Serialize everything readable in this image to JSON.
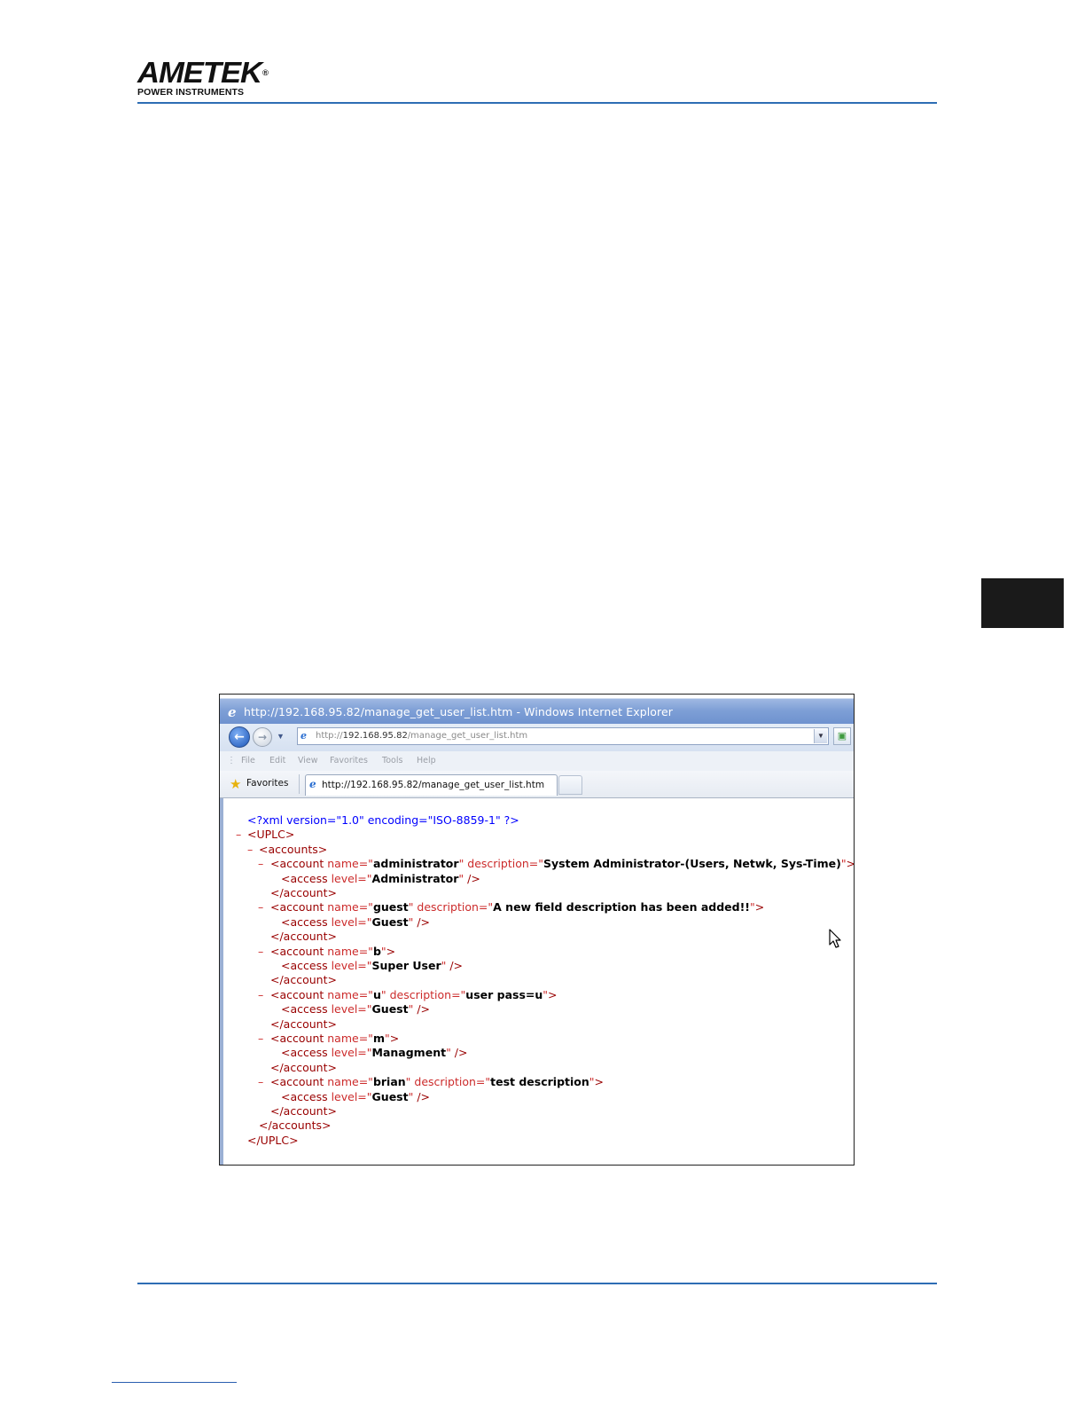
{
  "header": {
    "logo_text": "AMETEK",
    "logo_registered": "®",
    "logo_subtitle": "POWER INSTRUMENTS"
  },
  "browser": {
    "title": "http://192.168.95.82/manage_get_user_list.htm - Windows Internet Explorer",
    "address": {
      "protocol": "http://",
      "host": "192.168.95.82",
      "path": "/manage_get_user_list.htm"
    },
    "menu": [
      "File",
      "Edit",
      "View",
      "Favorites",
      "Tools",
      "Help"
    ],
    "favorites_label": "Favorites",
    "tab_label": "http://192.168.95.82/manage_get_user_list.htm",
    "icons": {
      "back": "back-arrow-icon",
      "forward": "forward-arrow-icon",
      "dropdown": "chevron-down-icon",
      "ie_page": "ie-logo-icon",
      "compat": "compatibility-view-icon",
      "favorites": "star-icon",
      "cursor": "mouse-pointer-icon"
    }
  },
  "xml": {
    "declaration": "<?xml version=\"1.0\" encoding=\"ISO-8859-1\" ?>",
    "root_open": "<UPLC>",
    "root_close": "</UPLC>",
    "accounts_open": "<accounts>",
    "accounts_close": "</accounts>",
    "account_close": "</account>",
    "accounts": [
      {
        "name": "administrator",
        "description": "System Administrator-(Users, Netwk, Sys-Time)",
        "level": "Administrator"
      },
      {
        "name": "guest",
        "description": "A new field description has been added!!",
        "level": "Guest"
      },
      {
        "name": "b",
        "description": null,
        "level": "Super User"
      },
      {
        "name": "u",
        "description": "user pass=u",
        "level": "Guest"
      },
      {
        "name": "m",
        "description": null,
        "level": "Managment"
      },
      {
        "name": "brian",
        "description": "test description",
        "level": "Guest"
      }
    ]
  },
  "colors": {
    "rule_blue": "#2e6db4",
    "xml_markup_red": "#cc2b2b",
    "xml_tag_darkred": "#990000",
    "xml_pi_blue": "#0000ff"
  }
}
